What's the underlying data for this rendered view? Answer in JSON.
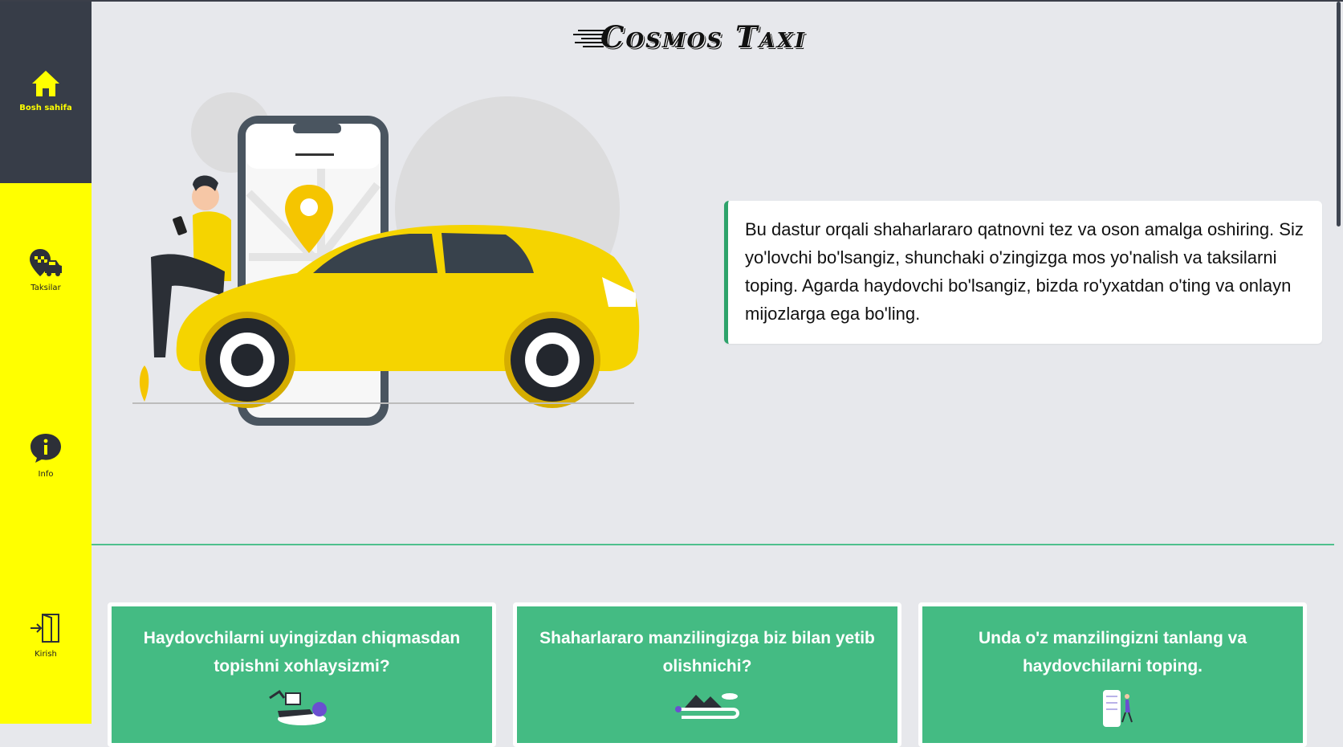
{
  "sidebar": {
    "items": [
      {
        "label": "Bosh sahifa",
        "icon": "home-icon"
      },
      {
        "label": "Taksilar",
        "icon": "taxi-pin-icon"
      },
      {
        "label": "Info",
        "icon": "info-icon"
      },
      {
        "label": "Kirish",
        "icon": "login-icon"
      }
    ]
  },
  "header": {
    "logo": "Cosmos Taxi"
  },
  "hero": {
    "description": "Bu dastur orqali shaharlararo qatnovni tez va oson amalga oshiring. Siz yo'lovchi bo'lsangiz, shunchaki o'zingizga mos yo'nalish va taksilarni toping. Agarda haydovchi bo'lsangiz, bizda ro'yxatdan o'ting va onlayn mijozlarga ega bo'ling."
  },
  "cards": [
    {
      "title": "Haydovchilarni uyingizdan chiqmasdan topishni xohlaysizmi?"
    },
    {
      "title": "Shaharlararo manzilingizga biz bilan yetib olishnichi?"
    },
    {
      "title": "Unda o'z manzilingizni tanlang va haydovchilarni toping."
    }
  ],
  "colors": {
    "sidebar": "#ffff00",
    "sidebar_active": "#373d48",
    "accent_green": "#44bb83",
    "background": "#e7e8ec"
  }
}
